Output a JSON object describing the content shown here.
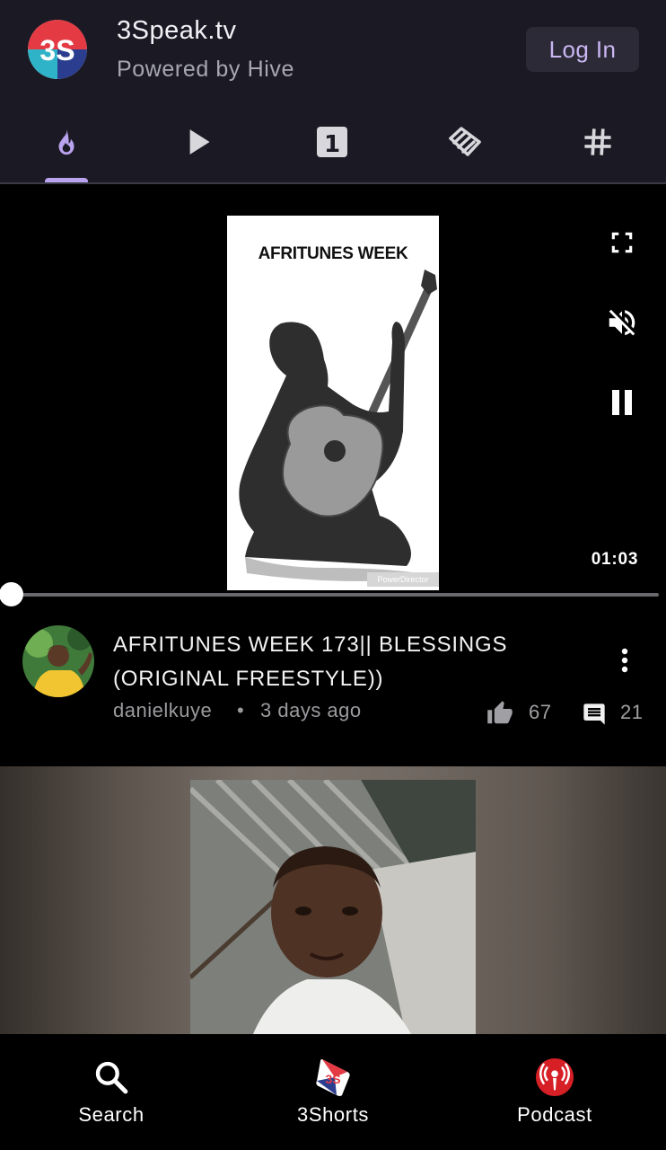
{
  "header": {
    "app_title": "3Speak.tv",
    "app_subtitle": "Powered by Hive",
    "login_label": "Log In",
    "logo_icon": "3speak-logo-icon"
  },
  "tabs": [
    {
      "icon": "flame-icon",
      "active": true
    },
    {
      "icon": "play-icon",
      "active": false
    },
    {
      "icon": "first-upload-icon",
      "active": false
    },
    {
      "icon": "community-icon",
      "active": false
    },
    {
      "icon": "hashtag-icon",
      "active": false
    }
  ],
  "player": {
    "thumbnail_title": "AFRITUNES WEEK",
    "thumbnail_watermark": "PowerDirector",
    "duration": "01:03",
    "progress": 0,
    "muted": true,
    "playing": true
  },
  "video": {
    "title": "AFRITUNES WEEK 173|| BLESSINGS (ORIGINAL FREESTYLE))",
    "author": "danielkuye",
    "separator": "•",
    "age": "3 days ago",
    "likes": "67",
    "comments": "21"
  },
  "bottom_nav": {
    "search_label": "Search",
    "shorts_label": "3Shorts",
    "podcast_label": "Podcast"
  },
  "colors": {
    "header_bg": "#1b1a24",
    "accent": "#b9a2ee",
    "login_bg": "#2b2a36",
    "podcast_red": "#d71f26"
  }
}
